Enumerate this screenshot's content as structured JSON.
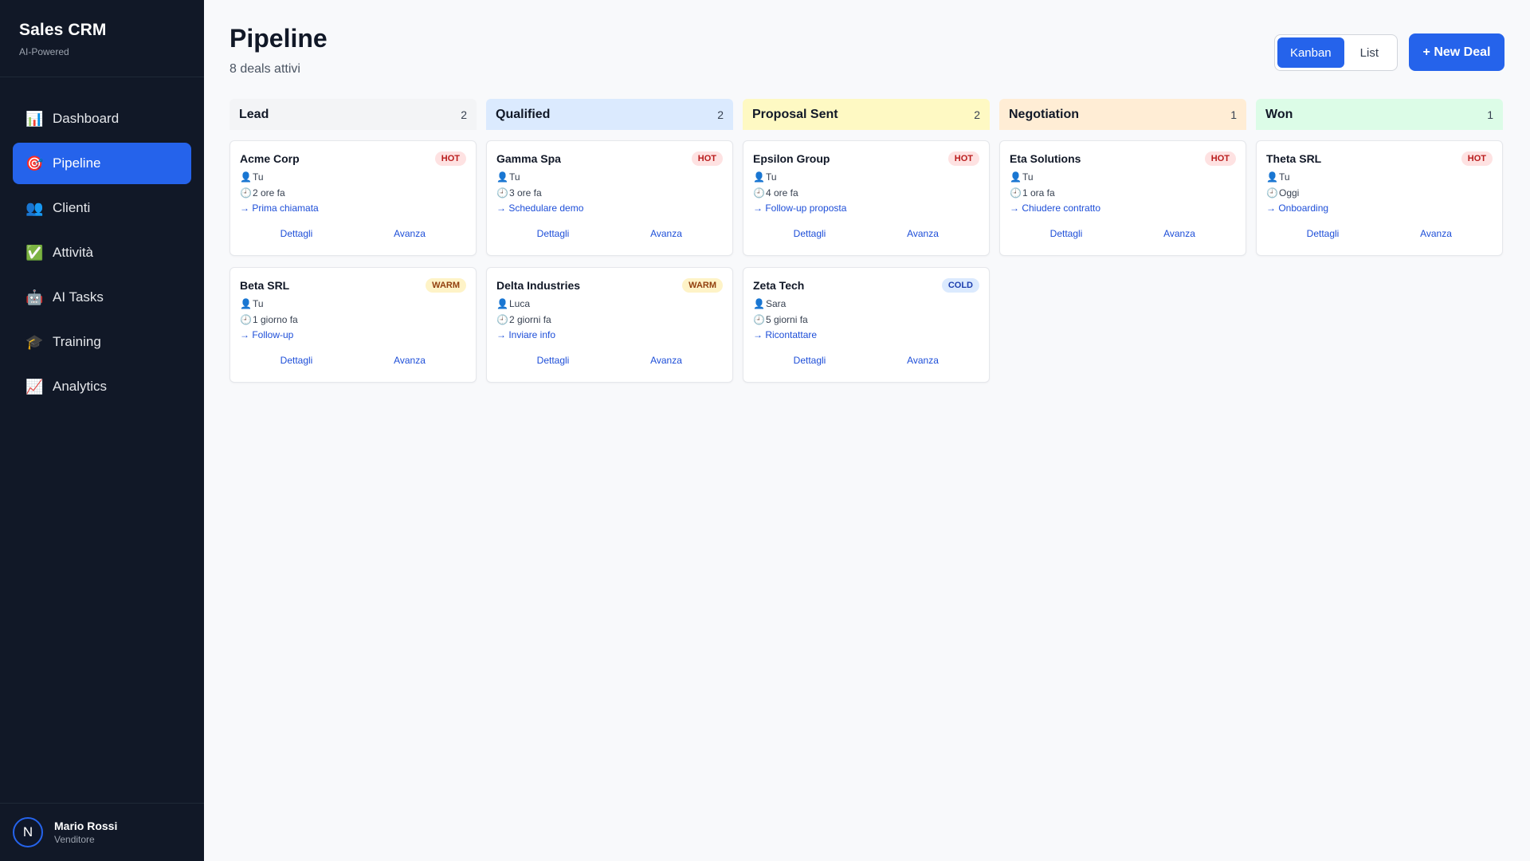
{
  "app": {
    "title": "Sales CRM",
    "subtitle": "AI-Powered"
  },
  "sidebar": {
    "items": [
      {
        "label": "Dashboard",
        "icon": "📊"
      },
      {
        "label": "Pipeline",
        "icon": "🎯",
        "active": true
      },
      {
        "label": "Clienti",
        "icon": "👥"
      },
      {
        "label": "Attività",
        "icon": "✅"
      },
      {
        "label": "AI Tasks",
        "icon": "🤖"
      },
      {
        "label": "Training",
        "icon": "🎓"
      },
      {
        "label": "Analytics",
        "icon": "📈"
      }
    ]
  },
  "user": {
    "initial": "N",
    "name": "Mario Rossi",
    "role": "Venditore"
  },
  "header": {
    "title": "Pipeline",
    "subtitle": "8 deals attivi",
    "views": [
      "Kanban",
      "List"
    ],
    "active_view": "Kanban",
    "new_deal_label": "+ New Deal"
  },
  "colors": {
    "accent": "#2563eb",
    "sidebar_bg": "#111827"
  },
  "columns": [
    {
      "title": "Lead",
      "count": "2",
      "bg": "#f3f4f6",
      "cards": [
        {
          "name": "Acme Corp",
          "badge": "HOT",
          "owner": "Tu",
          "time": "2 ore fa",
          "next": "→ Prima chiamata",
          "details": "Dettagli",
          "advance": "Avanza"
        },
        {
          "name": "Beta SRL",
          "badge": "WARM",
          "owner": "Tu",
          "time": "1 giorno fa",
          "next": "→ Follow-up",
          "details": "Dettagli",
          "advance": "Avanza"
        }
      ]
    },
    {
      "title": "Qualified",
      "count": "2",
      "bg": "#dbeafe",
      "cards": [
        {
          "name": "Gamma Spa",
          "badge": "HOT",
          "owner": "Tu",
          "time": "3 ore fa",
          "next": "→ Schedulare demo",
          "details": "Dettagli",
          "advance": "Avanza"
        },
        {
          "name": "Delta Industries",
          "badge": "WARM",
          "owner": "Luca",
          "time": "2 giorni fa",
          "next": "→ Inviare info",
          "details": "Dettagli",
          "advance": "Avanza"
        }
      ]
    },
    {
      "title": "Proposal Sent",
      "count": "2",
      "bg": "#fef9c3",
      "cards": [
        {
          "name": "Epsilon Group",
          "badge": "HOT",
          "owner": "Tu",
          "time": "4 ore fa",
          "next": "→ Follow-up proposta",
          "details": "Dettagli",
          "advance": "Avanza"
        },
        {
          "name": "Zeta Tech",
          "badge": "COLD",
          "owner": "Sara",
          "time": "5 giorni fa",
          "next": "→ Ricontattare",
          "details": "Dettagli",
          "advance": "Avanza"
        }
      ]
    },
    {
      "title": "Negotiation",
      "count": "1",
      "bg": "#ffedd5",
      "cards": [
        {
          "name": "Eta Solutions",
          "badge": "HOT",
          "owner": "Tu",
          "time": "1 ora fa",
          "next": "→ Chiudere contratto",
          "details": "Dettagli",
          "advance": "Avanza"
        }
      ]
    },
    {
      "title": "Won",
      "count": "1",
      "bg": "#dcfce7",
      "cards": [
        {
          "name": "Theta SRL",
          "badge": "HOT",
          "owner": "Tu",
          "time": "Oggi",
          "next": "→ Onboarding",
          "details": "Dettagli",
          "advance": "Avanza"
        }
      ]
    }
  ]
}
